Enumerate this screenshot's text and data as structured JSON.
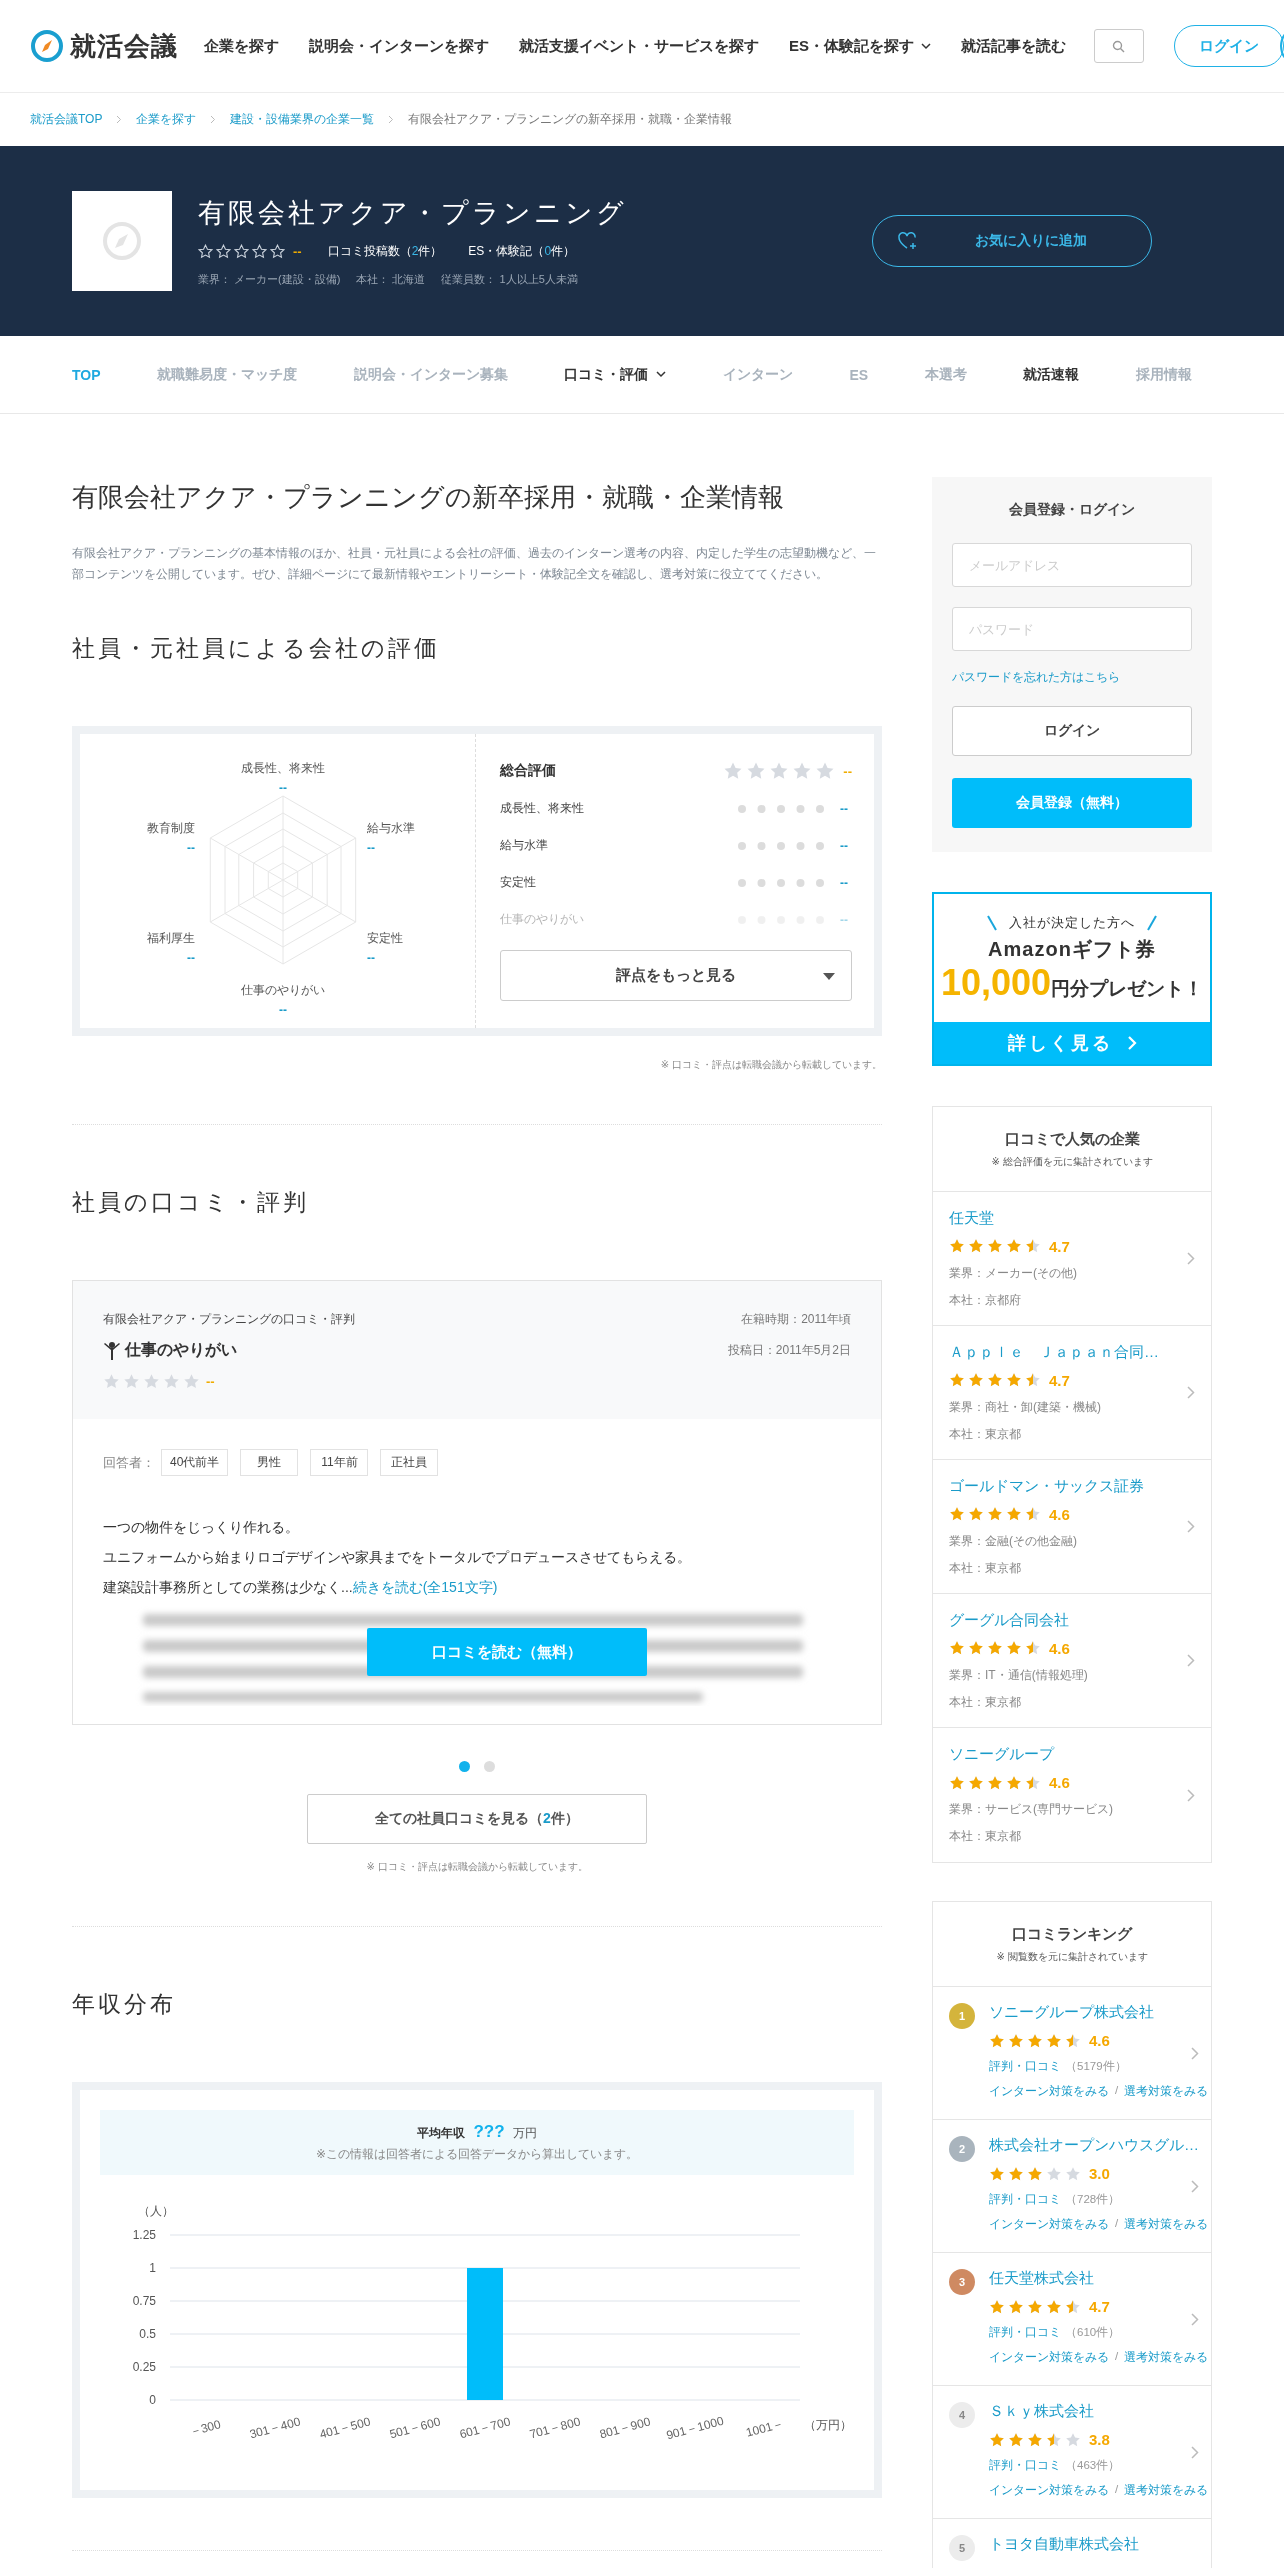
{
  "header": {
    "logo": "就活会議",
    "nav": [
      {
        "label": "企業を探す",
        "has_menu": false
      },
      {
        "label": "説明会・インターンを探す",
        "has_menu": false
      },
      {
        "label": "就活支援イベント・サービスを探す",
        "has_menu": false
      },
      {
        "label": "ES・体験記を探す",
        "has_menu": true
      },
      {
        "label": "就活記事を読む",
        "has_menu": false
      }
    ],
    "login": "ログイン"
  },
  "breadcrumb": [
    {
      "label": "就活会議TOP",
      "link": true
    },
    {
      "label": "企業を探す",
      "link": true
    },
    {
      "label": "建設・設備業界の企業一覧",
      "link": true
    },
    {
      "label": "有限会社アクア・プランニングの新卒採用・就職・企業情報",
      "link": false
    }
  ],
  "company": {
    "name": "有限会社アクア・プランニング",
    "stars": 0,
    "rating": "--",
    "counts": [
      {
        "prefix": "口コミ投稿数（",
        "count": "2",
        "suffix": "件）"
      },
      {
        "prefix": "ES・体験記（",
        "count": "0",
        "suffix": "件）"
      }
    ],
    "facts": [
      {
        "label": "業界：",
        "value": "メーカー(建設・設備)"
      },
      {
        "label": "本社：",
        "value": "北海道"
      },
      {
        "label": "従業員数：",
        "value": "1人以上5人未満"
      }
    ],
    "favorite": "お気に入りに追加"
  },
  "tabs": [
    {
      "label": "TOP",
      "selected": true,
      "disabled": false,
      "has_menu": false
    },
    {
      "label": "就職難易度・マッチ度",
      "selected": false,
      "disabled": true,
      "has_menu": false
    },
    {
      "label": "説明会・インターン募集",
      "selected": false,
      "disabled": true,
      "has_menu": false
    },
    {
      "label": "口コミ・評価",
      "selected": false,
      "disabled": false,
      "has_menu": true
    },
    {
      "label": "インターン",
      "selected": false,
      "disabled": true,
      "has_menu": false
    },
    {
      "label": "ES",
      "selected": false,
      "disabled": true,
      "has_menu": false
    },
    {
      "label": "本選考",
      "selected": false,
      "disabled": true,
      "has_menu": false
    },
    {
      "label": "就活速報",
      "selected": false,
      "disabled": false,
      "has_menu": false
    },
    {
      "label": "採用情報",
      "selected": false,
      "disabled": true,
      "has_menu": false
    }
  ],
  "intro": {
    "title": "有限会社アクア・プランニングの新卒採用・就職・企業情報",
    "text": "有限会社アクア・プランニングの基本情報のほか、社員・元社員による会社の評価、過去のインターン選考の内容、内定した学生の志望動機など、一部コンテンツを公開しています。ぜひ、詳細ページにて最新情報やエントリーシート・体験記全文を確認し、選考対策に役立ててください。"
  },
  "ratings": {
    "title": "社員・元社員による会社の評価",
    "radar": [
      {
        "label": "成長性、将来性",
        "value": "--"
      },
      {
        "label": "教育制度",
        "value": "--"
      },
      {
        "label": "給与水準",
        "value": "--"
      },
      {
        "label": "福利厚生",
        "value": "--"
      },
      {
        "label": "安定性",
        "value": "--"
      },
      {
        "label": "仕事のやりがい",
        "value": "--"
      }
    ],
    "overall": {
      "label": "総合評価",
      "stars": 0,
      "value": "--"
    },
    "rows": [
      {
        "label": "成長性、将来性",
        "value": "--",
        "dimmed": false
      },
      {
        "label": "給与水準",
        "value": "--",
        "dimmed": false
      },
      {
        "label": "安定性",
        "value": "--",
        "dimmed": false
      },
      {
        "label": "仕事のやりがい",
        "value": "--",
        "dimmed": true
      }
    ],
    "more": "評点をもっと見る",
    "note": "※ 口コミ・評点は転職会議から転載しています。"
  },
  "reviews": {
    "title": "社員の口コミ・評判",
    "card": {
      "source": "有限会社アクア・プランニングの口コミ・評判",
      "topic": "仕事のやりがい",
      "stars": 0,
      "rating": "--",
      "tenure": "在籍時期：2011年頃",
      "posted": "投稿日：2011年5月2日",
      "respondent_label": "回答者：",
      "tags": [
        "40代前半",
        "男性",
        "11年前",
        "正社員"
      ],
      "lines": [
        "一つの物件をじっくり作れる。",
        "ユニフォームから始まりロゴデザインや家具までをトータルでプロデュースさせてもらえる。"
      ],
      "last_line": "建築設計事務所としての業務は少なく...",
      "read_more": "続きを読む(全151文字)",
      "cta": "口コミを読む（無料）"
    },
    "pages": [
      {
        "selected": true
      },
      {
        "selected": false
      }
    ],
    "all": {
      "prefix": "全ての社員口コミを見る（",
      "count": "2",
      "suffix": "件）"
    },
    "note": "※ 口コミ・評点は転職会議から転載しています。"
  },
  "salary": {
    "title": "年収分布",
    "average": {
      "label": "平均年収",
      "value": "???",
      "unit": "万円",
      "note": "※この情報は回答者による回答データから算出しています。"
    },
    "chart_data": {
      "type": "bar",
      "ylabel": "（人）",
      "xlabel": "（万円）",
      "categories": [
        "－300",
        "301－400",
        "401－500",
        "501－600",
        "601－700",
        "701－800",
        "801－900",
        "901－1000",
        "1001－"
      ],
      "values": [
        0,
        0,
        0,
        0,
        1,
        0,
        0,
        0,
        0
      ],
      "ylim": [
        0,
        1.25
      ],
      "grid": true,
      "yticks": [
        0,
        0.25,
        0.5,
        0.75,
        1,
        1.25
      ]
    }
  },
  "sidebar": {
    "login": {
      "title": "会員登録・ログイン",
      "email_placeholder": "メールアドレス",
      "password_placeholder": "パスワード",
      "forgot": "パスワードを忘れた方はこちら",
      "login": "ログイン",
      "register": "会員登録（無料）"
    },
    "promo": {
      "lead": "入社が決定した方へ",
      "brand": "Amazonギフト券",
      "amount": "10,000",
      "suffix": "円分プレゼント！",
      "cta": "詳しく見る"
    },
    "popular": {
      "title": "口コミで人気の企業",
      "note": "※ 総合評価を元に集計されています",
      "items": [
        {
          "name": "任天堂",
          "stars": 4.5,
          "rating": "4.7",
          "industry": "業界：メーカー(その他)",
          "hq": "本社：京都府"
        },
        {
          "name": "Ａｐｐｌｅ　Ｊａｐａｎ合同…",
          "stars": 4.5,
          "rating": "4.7",
          "industry": "業界：商社・卸(建築・機械)",
          "hq": "本社：東京都"
        },
        {
          "name": "ゴールドマン・サックス証券",
          "stars": 4.5,
          "rating": "4.6",
          "industry": "業界：金融(その他金融)",
          "hq": "本社：東京都"
        },
        {
          "name": "グーグル合同会社",
          "stars": 4.5,
          "rating": "4.6",
          "industry": "業界：IT・通信(情報処理)",
          "hq": "本社：東京都"
        },
        {
          "name": "ソニーグループ",
          "stars": 4.5,
          "rating": "4.6",
          "industry": "業界：サービス(専門サービス)",
          "hq": "本社：東京都"
        }
      ]
    },
    "ranking": {
      "title": "口コミランキング",
      "note": "※ 閲覧数を元に集計されています",
      "items": [
        {
          "rank": "1",
          "color": "#d4b43c",
          "medal": true,
          "name": "ソニーグループ株式会社",
          "stars": 4.5,
          "rating": "4.6",
          "reviews_link": "評判・口コミ",
          "count": "（5179件）",
          "intern_link": "インターン対策をみる",
          "separator": "/",
          "selection_link": "選考対策をみる"
        },
        {
          "rank": "2",
          "color": "#a9b4bd",
          "medal": true,
          "name": "株式会社オープンハウスグル…",
          "stars": 3,
          "rating": "3.0",
          "reviews_link": "評判・口コミ",
          "count": "（728件）",
          "intern_link": "インターン対策をみる",
          "separator": "/",
          "selection_link": "選考対策をみる"
        },
        {
          "rank": "3",
          "color": "#cf8a62",
          "medal": true,
          "name": "任天堂株式会社",
          "stars": 4.5,
          "rating": "4.7",
          "reviews_link": "評判・口コミ",
          "count": "（610件）",
          "intern_link": "インターン対策をみる",
          "separator": "/",
          "selection_link": "選考対策をみる"
        },
        {
          "rank": "4",
          "color": "#ececec",
          "medal": false,
          "name": "Ｓｋｙ株式会社",
          "stars": 3.5,
          "rating": "3.8",
          "reviews_link": "評判・口コミ",
          "count": "（463件）",
          "intern_link": "インターン対策をみる",
          "separator": "/",
          "selection_link": "選考対策をみる"
        },
        {
          "rank": "5",
          "color": "#ececec",
          "medal": false,
          "name": "トヨタ自動車株式会社"
        }
      ]
    }
  }
}
